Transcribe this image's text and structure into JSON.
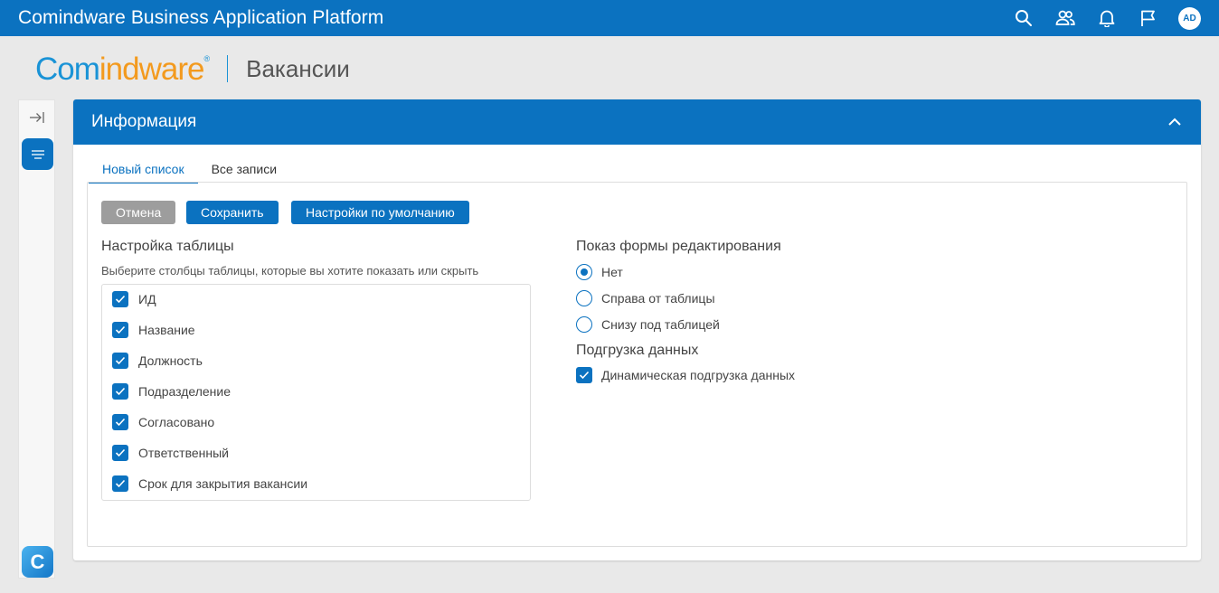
{
  "topbar": {
    "app_title": "Comindware Business Application Platform",
    "avatar_initials": "AD",
    "icons": [
      "search-icon",
      "users-icon",
      "bell-icon",
      "flag-icon"
    ]
  },
  "brand": {
    "logo_part1": "Com",
    "logo_part2": "indware",
    "page_title": "Вакансии"
  },
  "panel": {
    "title": "Информация",
    "tabs": [
      {
        "label": "Новый список",
        "active": true
      },
      {
        "label": "Все записи",
        "active": false
      }
    ],
    "buttons": {
      "cancel": "Отмена",
      "save": "Сохранить",
      "defaults": "Настройки по умолчанию"
    },
    "table_settings": {
      "title": "Настройка таблицы",
      "hint": "Выберите столбцы таблицы, которые вы хотите показать или скрыть",
      "columns": [
        {
          "label": "ИД",
          "checked": true
        },
        {
          "label": "Название",
          "checked": true
        },
        {
          "label": "Должность",
          "checked": true
        },
        {
          "label": "Подразделение",
          "checked": true
        },
        {
          "label": "Согласовано",
          "checked": true
        },
        {
          "label": "Ответственный",
          "checked": true
        },
        {
          "label": "Срок для закрытия вакансии",
          "checked": true
        }
      ]
    },
    "edit_form": {
      "title": "Показ формы редактирования",
      "options": [
        {
          "label": "Нет",
          "selected": true
        },
        {
          "label": "Справа от таблицы",
          "selected": false
        },
        {
          "label": "Снизу под таблицей",
          "selected": false
        }
      ]
    },
    "data_loading": {
      "title": "Подгрузка данных",
      "dynamic_label": "Динамическая подгрузка данных",
      "dynamic_checked": true
    }
  },
  "colors": {
    "primary": "#0b72c0",
    "logo_blue": "#1a93d6",
    "logo_orange": "#f39a1e",
    "cancel_grey": "#9d9d9d"
  }
}
